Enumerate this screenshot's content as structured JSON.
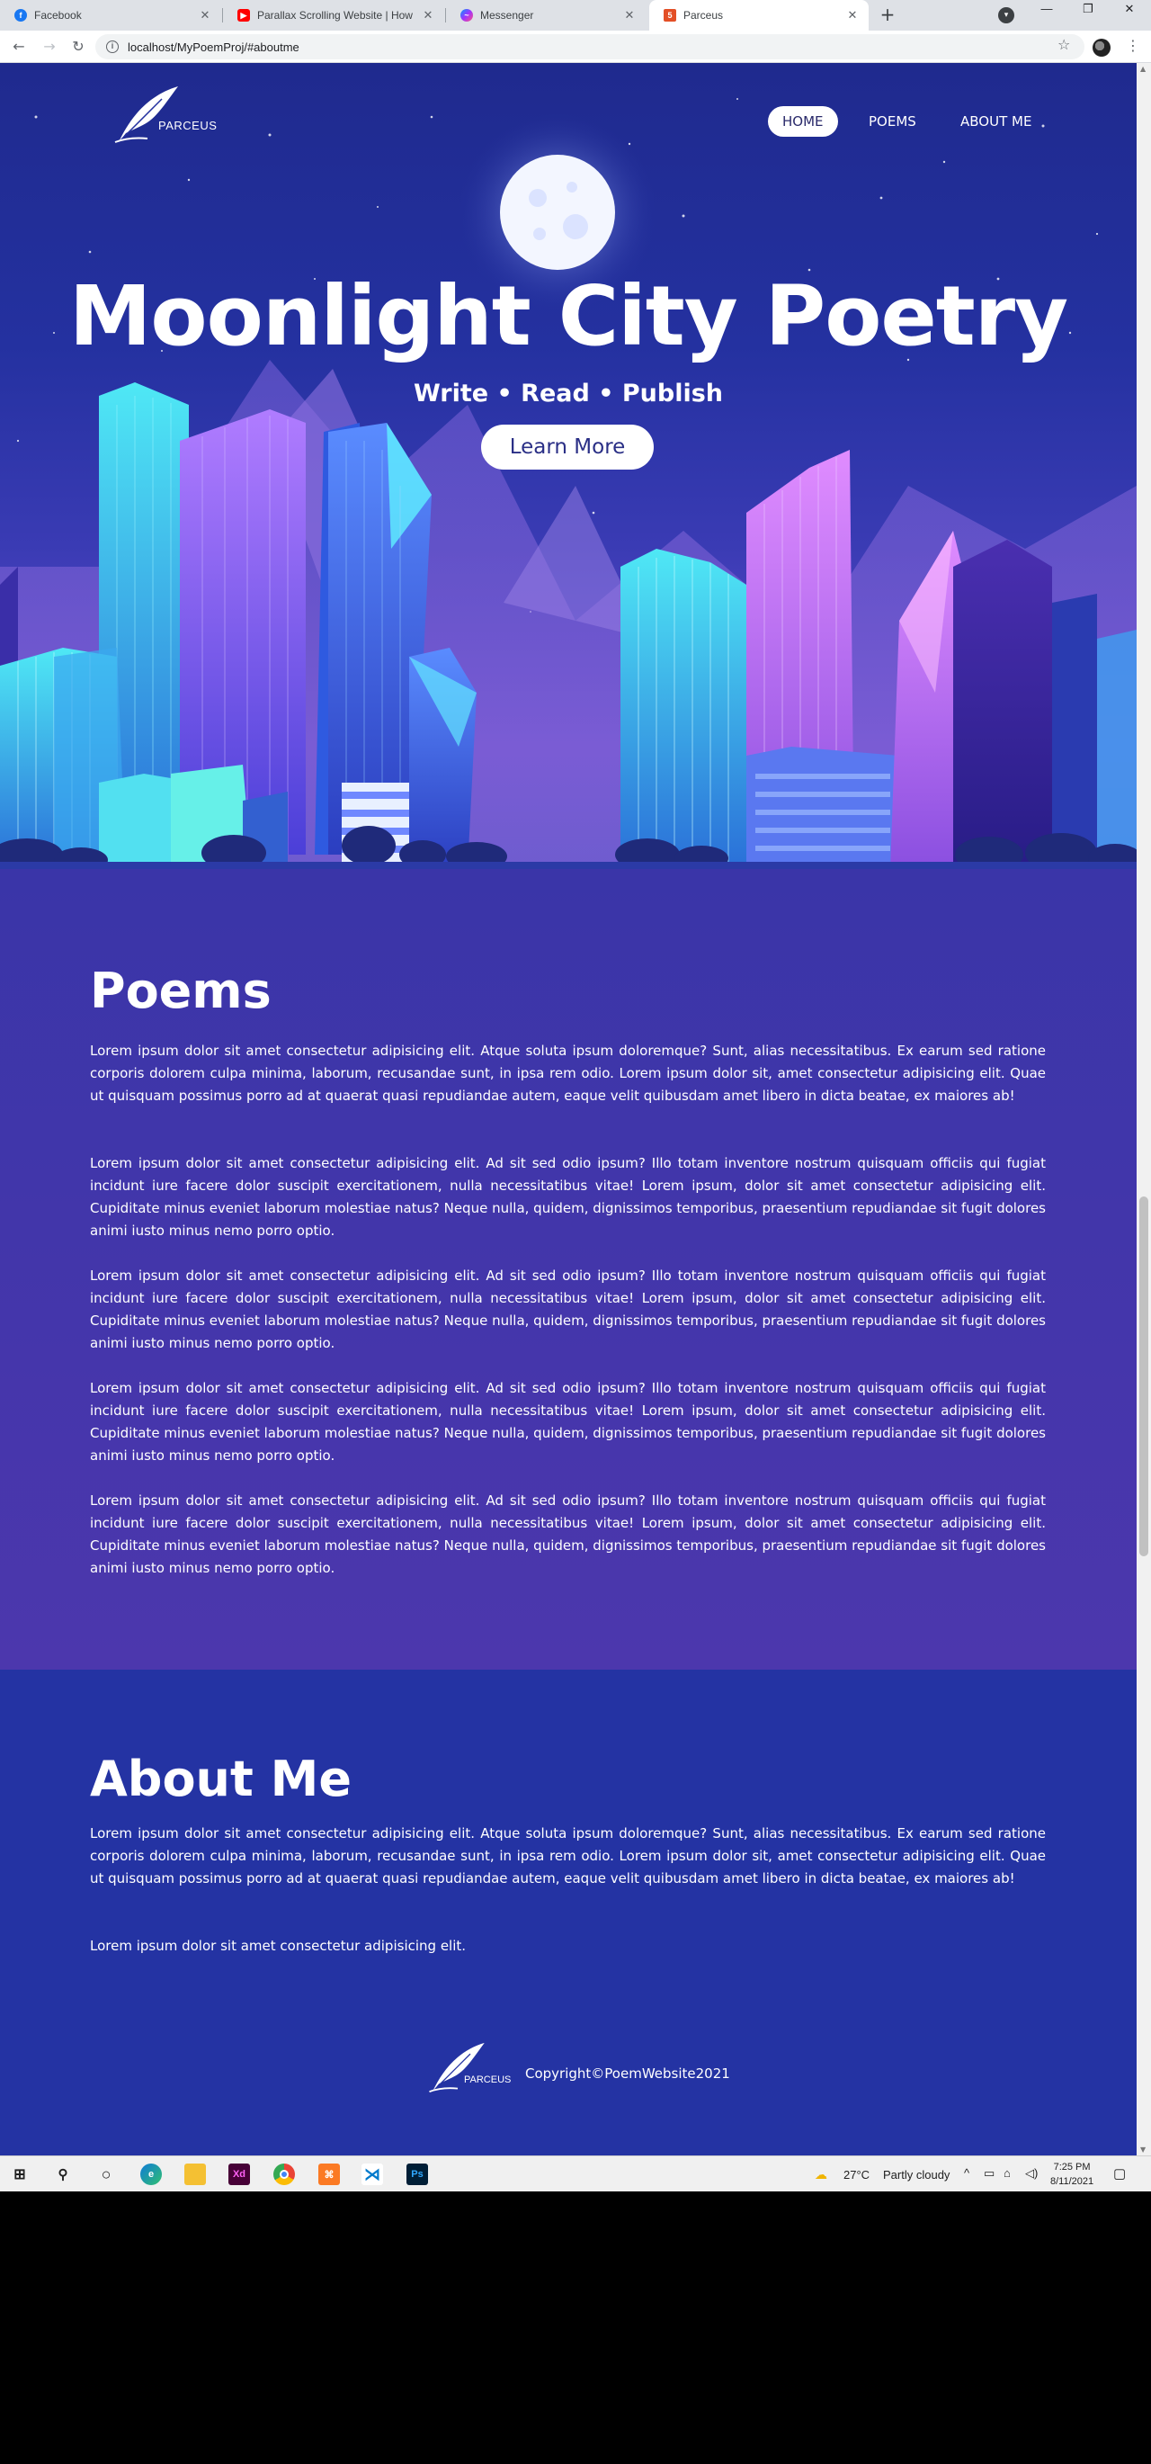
{
  "browser": {
    "tabs": [
      {
        "title": "Facebook",
        "icon": "facebook-icon",
        "color": "#1877f2"
      },
      {
        "title": "Parallax Scrolling Website | How",
        "icon": "youtube-icon",
        "color": "#ff0000"
      },
      {
        "title": "Messenger",
        "icon": "messenger-icon",
        "color": "#a033ff"
      },
      {
        "title": "Parceus",
        "icon": "html5-icon",
        "color": "#e34f26"
      }
    ],
    "new_tab": "+",
    "url": "localhost/MyPoemProj/#aboutme"
  },
  "site": {
    "logo_text": "PARCEUS",
    "nav": [
      "HOME",
      "POEMS",
      "ABOUT ME"
    ],
    "hero": {
      "title": "Moonlight City Poetry",
      "subtitle": "Write • Read • Publish",
      "cta": "Learn More"
    },
    "poems": {
      "heading": "Poems",
      "paragraphs": [
        "Lorem ipsum dolor sit amet consectetur adipisicing elit. Atque soluta ipsum doloremque? Sunt, alias necessitatibus. Ex earum sed ratione corporis dolorem culpa minima, laborum, recusandae sunt, in ipsa rem odio. Lorem ipsum dolor sit, amet consectetur adipisicing elit. Quae ut quisquam possimus porro ad at quaerat quasi repudiandae autem, eaque velit quibusdam amet libero in dicta beatae, ex maiores ab!",
        "Lorem ipsum dolor sit amet consectetur adipisicing elit. Ad sit sed odio ipsum? Illo totam inventore nostrum quisquam officiis qui fugiat incidunt iure facere dolor suscipit exercitationem, nulla necessitatibus vitae! Lorem ipsum, dolor sit amet consectetur adipisicing elit. Cupiditate minus eveniet laborum molestiae natus? Neque nulla, quidem, dignissimos temporibus, praesentium repudiandae sit fugit dolores animi iusto minus nemo porro optio.",
        "Lorem ipsum dolor sit amet consectetur adipisicing elit. Ad sit sed odio ipsum? Illo totam inventore nostrum quisquam officiis qui fugiat incidunt iure facere dolor suscipit exercitationem, nulla necessitatibus vitae! Lorem ipsum, dolor sit amet consectetur adipisicing elit. Cupiditate minus eveniet laborum molestiae natus? Neque nulla, quidem, dignissimos temporibus, praesentium repudiandae sit fugit dolores animi iusto minus nemo porro optio.",
        "Lorem ipsum dolor sit amet consectetur adipisicing elit. Ad sit sed odio ipsum? Illo totam inventore nostrum quisquam officiis qui fugiat incidunt iure facere dolor suscipit exercitationem, nulla necessitatibus vitae! Lorem ipsum, dolor sit amet consectetur adipisicing elit. Cupiditate minus eveniet laborum molestiae natus? Neque nulla, quidem, dignissimos temporibus, praesentium repudiandae sit fugit dolores animi iusto minus nemo porro optio.",
        "Lorem ipsum dolor sit amet consectetur adipisicing elit. Ad sit sed odio ipsum? Illo totam inventore nostrum quisquam officiis qui fugiat incidunt iure facere dolor suscipit exercitationem, nulla necessitatibus vitae! Lorem ipsum, dolor sit amet consectetur adipisicing elit. Cupiditate minus eveniet laborum molestiae natus? Neque nulla, quidem, dignissimos temporibus, praesentium repudiandae sit fugit dolores animi iusto minus nemo porro optio."
      ]
    },
    "about": {
      "heading": "About Me",
      "paragraphs": [
        "Lorem ipsum dolor sit amet consectetur adipisicing elit. Atque soluta ipsum doloremque? Sunt, alias necessitatibus. Ex earum sed ratione corporis dolorem culpa minima, laborum, recusandae sunt, in ipsa rem odio. Lorem ipsum dolor sit, amet consectetur adipisicing elit. Quae ut quisquam possimus porro ad at quaerat quasi repudiandae autem, eaque velit quibusdam amet libero in dicta beatae, ex maiores ab!",
        "Lorem ipsum dolor sit amet consectetur adipisicing elit."
      ]
    },
    "footer": {
      "logo_text": "PARCEUS",
      "copyright": "Copyright©PoemWebsite2021"
    },
    "colors": {
      "hero_bg": "#2431a0",
      "poems_bg": "#4237ab",
      "about_bg": "#2433a3",
      "accent": "#2a2f86"
    }
  },
  "taskbar": {
    "weather_temp": "27°C",
    "weather_text": "Partly cloudy",
    "time": "7:25 PM",
    "date": "8/11/2021",
    "apps": [
      "windows-start-icon",
      "search-icon",
      "cortana-icon",
      "edge-icon",
      "file-explorer-icon",
      "adobe-xd-icon",
      "chrome-icon",
      "xampp-icon",
      "vscode-icon",
      "photoshop-icon"
    ],
    "app_labels": {
      "xd": "Xd",
      "ps": "Ps"
    }
  }
}
